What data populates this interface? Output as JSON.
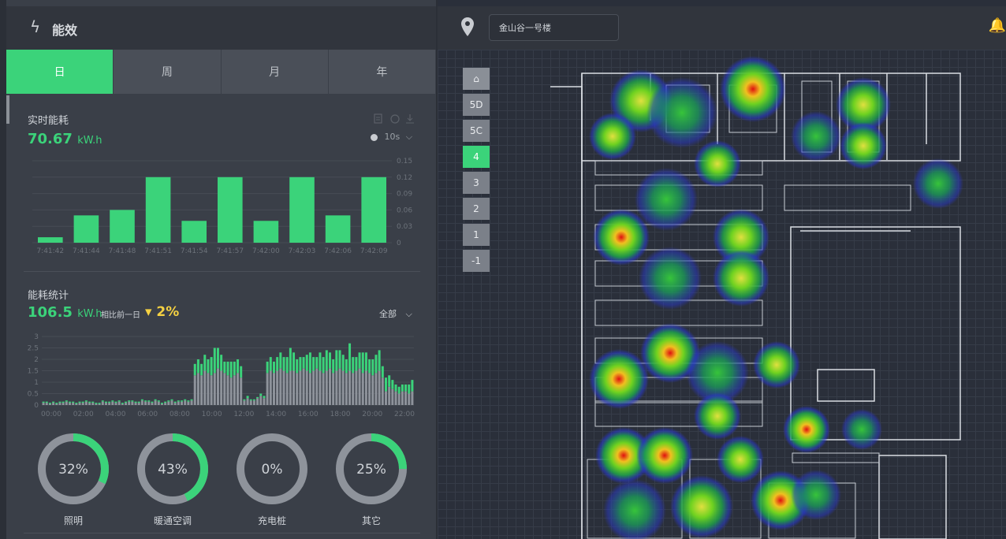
{
  "panel": {
    "title": "能效"
  },
  "tabs": [
    {
      "label": "日",
      "active": true
    },
    {
      "label": "周",
      "active": false
    },
    {
      "label": "月",
      "active": false
    },
    {
      "label": "年",
      "active": false
    }
  ],
  "realtime": {
    "title": "实时能耗",
    "value": "70.67",
    "unit": "kW.h",
    "interval": "10s",
    "chart_data": {
      "type": "bar",
      "categories": [
        "7:41:42",
        "7:41:44",
        "7:41:48",
        "7:41:51",
        "7:41:54",
        "7:41:57",
        "7:42:00",
        "7:42:03",
        "7:42:06",
        "7:42:09"
      ],
      "values": [
        0.01,
        0.05,
        0.06,
        0.12,
        0.04,
        0.12,
        0.04,
        0.12,
        0.05,
        0.12
      ],
      "yticks": [
        "0.15",
        "0.12",
        "0.09",
        "0.06",
        "0.03",
        "0"
      ],
      "ylim": [
        0,
        0.15
      ],
      "color": "#3bd37a"
    }
  },
  "stats": {
    "title": "能耗统计",
    "value": "106.5",
    "unit": "kW.h",
    "compare_label": "相比前一日",
    "compare_arrow": "▼",
    "compare_value": "2%",
    "filter": "全部",
    "chart_data": {
      "type": "bar",
      "xticks": [
        "00:00",
        "02:00",
        "04:00",
        "06:00",
        "08:00",
        "10:00",
        "12:00",
        "14:00",
        "16:00",
        "18:00",
        "20:00",
        "22:00"
      ],
      "yticks": [
        "3",
        "2.5",
        "2",
        "1.5",
        "1",
        "0.5",
        "0"
      ],
      "ylim": [
        0,
        3
      ],
      "series": [
        {
          "color": "#8e939b",
          "values": [
            0.1,
            0.1,
            0.05,
            0.1,
            0.05,
            0.1,
            0.1,
            0.15,
            0.1,
            0.1,
            0.05,
            0.1,
            0.1,
            0.15,
            0.1,
            0.1,
            0.05,
            0.05,
            0.15,
            0.1,
            0.1,
            0.15,
            0.1,
            0.15,
            0.05,
            0.1,
            0.15,
            0.15,
            0.1,
            0.1,
            0.2,
            0.15,
            0.15,
            0.1,
            0.2,
            0.15,
            0.05,
            0.1,
            0.15,
            0.2,
            0.1,
            0.15,
            0.15,
            0.2,
            0.15,
            0.2,
            1.3,
            1.4,
            1.3,
            1.5,
            1.4,
            1.3,
            1.4,
            1.6,
            1.5,
            1.4,
            1.3,
            1.2,
            1.3,
            1.4,
            1.2,
            0.2,
            0.3,
            0.2,
            0.2,
            0.3,
            0.4,
            0.3,
            1.4,
            1.5,
            1.4,
            1.5,
            1.6,
            1.5,
            1.4,
            1.5,
            1.5,
            1.4,
            1.5,
            1.6,
            1.5,
            1.4,
            1.5,
            1.6,
            1.5,
            1.4,
            1.5,
            1.6,
            1.4,
            1.5,
            1.6,
            1.5,
            1.4,
            1.5,
            1.4,
            1.5,
            1.6,
            1.4,
            1.5,
            1.4,
            1.3,
            1.4,
            1.5,
            1.2,
            0.6,
            0.8,
            0.7,
            0.6,
            0.5,
            0.6,
            0.6,
            0.5,
            0.6
          ]
        },
        {
          "color": "#3bd37a",
          "values": [
            0.05,
            0.05,
            0.05,
            0.05,
            0.05,
            0.05,
            0.05,
            0.05,
            0.05,
            0.05,
            0.05,
            0.05,
            0.05,
            0.05,
            0.05,
            0.05,
            0.05,
            0.05,
            0.05,
            0.05,
            0.05,
            0.05,
            0.05,
            0.05,
            0.05,
            0.05,
            0.05,
            0.05,
            0.05,
            0.05,
            0.05,
            0.05,
            0.05,
            0.05,
            0.05,
            0.05,
            0.05,
            0.05,
            0.05,
            0.05,
            0.05,
            0.05,
            0.05,
            0.05,
            0.05,
            0.05,
            0.5,
            0.6,
            0.5,
            0.7,
            0.6,
            0.8,
            1.1,
            0.9,
            0.7,
            0.5,
            0.6,
            0.7,
            0.6,
            0.6,
            0.5,
            0.05,
            0.1,
            0.05,
            0.05,
            0.05,
            0.1,
            0.1,
            0.5,
            0.6,
            0.5,
            0.6,
            0.7,
            0.6,
            0.7,
            1.0,
            0.8,
            0.6,
            0.6,
            0.5,
            0.7,
            0.9,
            0.6,
            0.5,
            0.8,
            0.7,
            0.9,
            0.7,
            0.6,
            0.9,
            0.8,
            0.7,
            0.6,
            1.2,
            0.7,
            0.6,
            0.7,
            0.9,
            0.8,
            0.6,
            0.7,
            0.8,
            0.9,
            0.5,
            0.6,
            0.5,
            0.4,
            0.3,
            0.3,
            0.3,
            0.3,
            0.4,
            0.5
          ]
        }
      ]
    }
  },
  "donuts": [
    {
      "label": "照明",
      "value": 32
    },
    {
      "label": "暖通空调",
      "value": 43
    },
    {
      "label": "充电桩",
      "value": 0
    },
    {
      "label": "其它",
      "value": 25
    }
  ],
  "map": {
    "building": "金山谷一号楼",
    "floors": [
      {
        "label": "5D",
        "active": false
      },
      {
        "label": "5C",
        "active": false
      },
      {
        "label": "4",
        "active": true
      },
      {
        "label": "3",
        "active": false
      },
      {
        "label": "2",
        "active": false
      },
      {
        "label": "1",
        "active": false
      },
      {
        "label": "-1",
        "active": false
      }
    ]
  },
  "colors": {
    "accent": "#3bd37a",
    "warn": "#f5d142",
    "panel": "#3a3f48"
  }
}
